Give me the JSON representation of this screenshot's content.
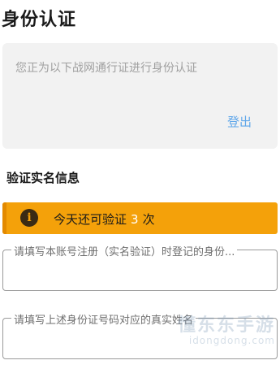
{
  "page": {
    "title": "身份认证"
  },
  "account_card": {
    "message": "您正为以下战网通行证进行身份认证",
    "logout_label": "登出"
  },
  "verify_section": {
    "title": "验证实名信息"
  },
  "notice": {
    "icon": "info-icon",
    "icon_glyph": "i",
    "prefix": "今天还可验证",
    "count": "3",
    "suffix": "次",
    "colors": {
      "background": "#f4a10a",
      "count": "#ffffff"
    }
  },
  "form": {
    "name_field": {
      "label": "请填写本账号注册（实名验证）时登记的身份...",
      "value": ""
    },
    "id_field": {
      "label": "请填写上述身份证号码对应的真实姓名",
      "value": ""
    }
  },
  "watermark": {
    "title": "懂东东手游",
    "sub": "idongdong.com"
  },
  "colors": {
    "link": "#62a8ea",
    "card_bg": "#f2f2f2"
  }
}
